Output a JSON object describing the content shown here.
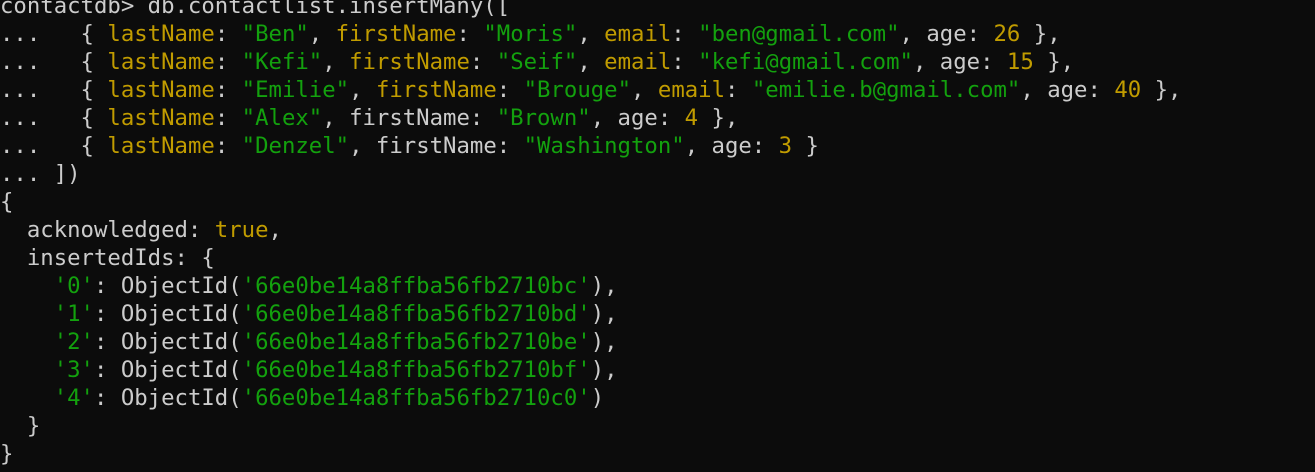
{
  "terminal": {
    "lines": [
      [
        {
          "text": "contactdb> db.contactlist.insertMany([",
          "cls": "plain"
        }
      ],
      [
        {
          "text": "...   { ",
          "cls": "plain"
        },
        {
          "text": "lastName",
          "cls": "key"
        },
        {
          "text": ": ",
          "cls": "plain"
        },
        {
          "text": "\"Ben\"",
          "cls": "str"
        },
        {
          "text": ", ",
          "cls": "plain"
        },
        {
          "text": "firstName",
          "cls": "key"
        },
        {
          "text": ": ",
          "cls": "plain"
        },
        {
          "text": "\"Moris\"",
          "cls": "str"
        },
        {
          "text": ", ",
          "cls": "plain"
        },
        {
          "text": "email",
          "cls": "key"
        },
        {
          "text": ": ",
          "cls": "plain"
        },
        {
          "text": "\"ben@gmail.com\"",
          "cls": "str"
        },
        {
          "text": ", age: ",
          "cls": "plain"
        },
        {
          "text": "26",
          "cls": "num"
        },
        {
          "text": " },",
          "cls": "plain"
        }
      ],
      [
        {
          "text": "...   { ",
          "cls": "plain"
        },
        {
          "text": "lastName",
          "cls": "key"
        },
        {
          "text": ": ",
          "cls": "plain"
        },
        {
          "text": "\"Kefi\"",
          "cls": "str"
        },
        {
          "text": ", ",
          "cls": "plain"
        },
        {
          "text": "firstName",
          "cls": "key"
        },
        {
          "text": ": ",
          "cls": "plain"
        },
        {
          "text": "\"Seif\"",
          "cls": "str"
        },
        {
          "text": ", ",
          "cls": "plain"
        },
        {
          "text": "email",
          "cls": "key"
        },
        {
          "text": ": ",
          "cls": "plain"
        },
        {
          "text": "\"kefi@gmail.com\"",
          "cls": "str"
        },
        {
          "text": ", age: ",
          "cls": "plain"
        },
        {
          "text": "15",
          "cls": "num"
        },
        {
          "text": " },",
          "cls": "plain"
        }
      ],
      [
        {
          "text": "...   { ",
          "cls": "plain"
        },
        {
          "text": "lastName",
          "cls": "key"
        },
        {
          "text": ": ",
          "cls": "plain"
        },
        {
          "text": "\"Emilie\"",
          "cls": "str"
        },
        {
          "text": ", ",
          "cls": "plain"
        },
        {
          "text": "firstName",
          "cls": "key"
        },
        {
          "text": ": ",
          "cls": "plain"
        },
        {
          "text": "\"Brouge\"",
          "cls": "str"
        },
        {
          "text": ", ",
          "cls": "plain"
        },
        {
          "text": "email",
          "cls": "key"
        },
        {
          "text": ": ",
          "cls": "plain"
        },
        {
          "text": "\"emilie.b@gmail.com\"",
          "cls": "str"
        },
        {
          "text": ", age: ",
          "cls": "plain"
        },
        {
          "text": "40",
          "cls": "num"
        },
        {
          "text": " },",
          "cls": "plain"
        }
      ],
      [
        {
          "text": "...   { ",
          "cls": "plain"
        },
        {
          "text": "lastName",
          "cls": "key"
        },
        {
          "text": ": ",
          "cls": "plain"
        },
        {
          "text": "\"Alex\"",
          "cls": "str"
        },
        {
          "text": ", firstName: ",
          "cls": "plain"
        },
        {
          "text": "\"Brown\"",
          "cls": "str"
        },
        {
          "text": ", age: ",
          "cls": "plain"
        },
        {
          "text": "4",
          "cls": "num"
        },
        {
          "text": " },",
          "cls": "plain"
        }
      ],
      [
        {
          "text": "...   { ",
          "cls": "plain"
        },
        {
          "text": "lastName",
          "cls": "key"
        },
        {
          "text": ": ",
          "cls": "plain"
        },
        {
          "text": "\"Denzel\"",
          "cls": "str"
        },
        {
          "text": ", firstName: ",
          "cls": "plain"
        },
        {
          "text": "\"Washington\"",
          "cls": "str"
        },
        {
          "text": ", age: ",
          "cls": "plain"
        },
        {
          "text": "3",
          "cls": "num"
        },
        {
          "text": " }",
          "cls": "plain"
        }
      ],
      [
        {
          "text": "... ])",
          "cls": "plain"
        }
      ],
      [
        {
          "text": "{",
          "cls": "plain"
        }
      ],
      [
        {
          "text": "  acknowledged: ",
          "cls": "plain"
        },
        {
          "text": "true",
          "cls": "bool"
        },
        {
          "text": ",",
          "cls": "plain"
        }
      ],
      [
        {
          "text": "  insertedIds: {",
          "cls": "plain"
        }
      ],
      [
        {
          "text": "    ",
          "cls": "plain"
        },
        {
          "text": "'0'",
          "cls": "str"
        },
        {
          "text": ": ObjectId(",
          "cls": "plain"
        },
        {
          "text": "'66e0be14a8ffba56fb2710bc'",
          "cls": "str"
        },
        {
          "text": "),",
          "cls": "plain"
        }
      ],
      [
        {
          "text": "    ",
          "cls": "plain"
        },
        {
          "text": "'1'",
          "cls": "str"
        },
        {
          "text": ": ObjectId(",
          "cls": "plain"
        },
        {
          "text": "'66e0be14a8ffba56fb2710bd'",
          "cls": "str"
        },
        {
          "text": "),",
          "cls": "plain"
        }
      ],
      [
        {
          "text": "    ",
          "cls": "plain"
        },
        {
          "text": "'2'",
          "cls": "str"
        },
        {
          "text": ": ObjectId(",
          "cls": "plain"
        },
        {
          "text": "'66e0be14a8ffba56fb2710be'",
          "cls": "str"
        },
        {
          "text": "),",
          "cls": "plain"
        }
      ],
      [
        {
          "text": "    ",
          "cls": "plain"
        },
        {
          "text": "'3'",
          "cls": "str"
        },
        {
          "text": ": ObjectId(",
          "cls": "plain"
        },
        {
          "text": "'66e0be14a8ffba56fb2710bf'",
          "cls": "str"
        },
        {
          "text": "),",
          "cls": "plain"
        }
      ],
      [
        {
          "text": "    ",
          "cls": "plain"
        },
        {
          "text": "'4'",
          "cls": "str"
        },
        {
          "text": ": ObjectId(",
          "cls": "plain"
        },
        {
          "text": "'66e0be14a8ffba56fb2710c0'",
          "cls": "str"
        },
        {
          "text": ")",
          "cls": "plain"
        }
      ],
      [
        {
          "text": "  }",
          "cls": "plain"
        }
      ],
      [
        {
          "text": "}",
          "cls": "plain"
        }
      ]
    ]
  },
  "colors": {
    "background": "#0c0c0c",
    "plain_text": "#cccccc",
    "key_yellow": "#c19c00",
    "string_green": "#13a10e",
    "number_yellow": "#c19c00"
  }
}
